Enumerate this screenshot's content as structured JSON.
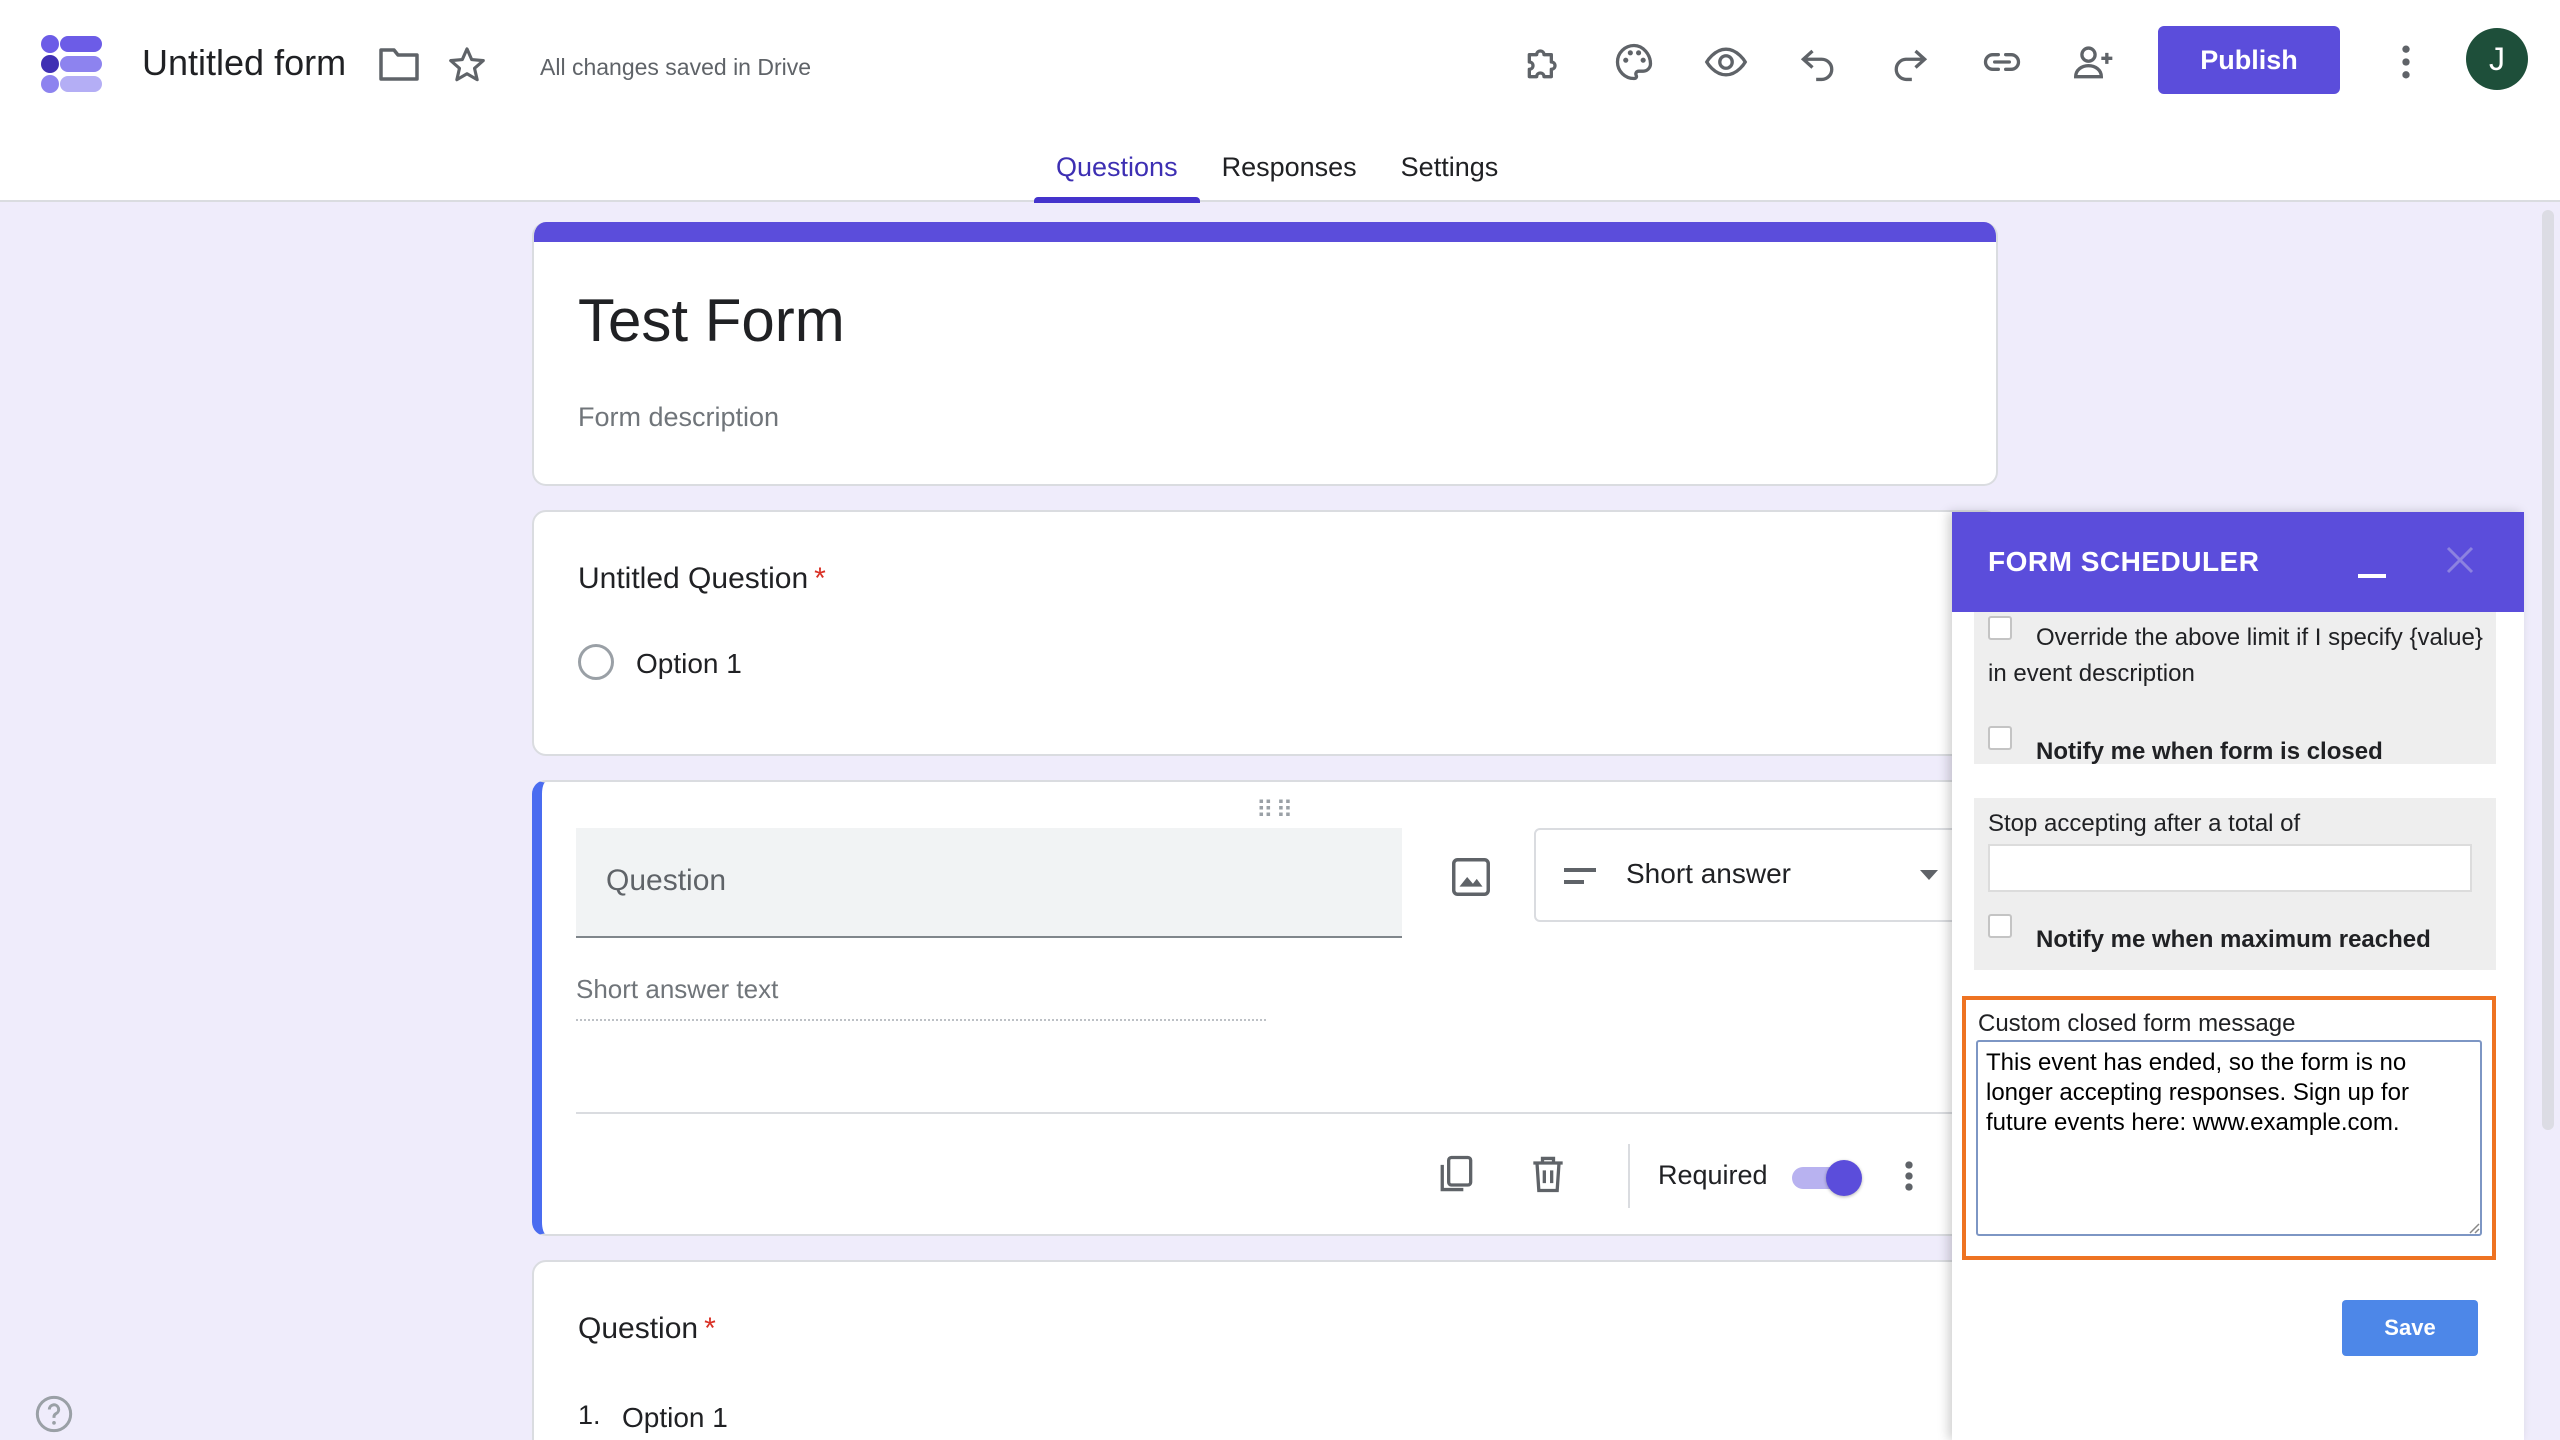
{
  "app": {
    "doc_title": "Untitled form",
    "save_status": "All changes saved in Drive",
    "publish_label": "Publish",
    "avatar_initial": "J",
    "brand_color": "#5b4ddb"
  },
  "toolbar_icons": [
    "addon-icon",
    "palette-icon",
    "preview-eye-icon",
    "undo-icon",
    "redo-icon",
    "link-icon",
    "add-collaborator-icon",
    "more-vert-icon"
  ],
  "tabs": [
    {
      "label": "Questions",
      "active": true
    },
    {
      "label": "Responses",
      "active": false
    },
    {
      "label": "Settings",
      "active": false
    }
  ],
  "form": {
    "title": "Test Form",
    "description_placeholder": "Form description",
    "question1": {
      "title": "Untitled Question",
      "required_mark": "*",
      "option": "Option 1"
    },
    "question2": {
      "title_placeholder": "Question",
      "type": "Short answer",
      "answer_placeholder": "Short answer text",
      "required_label": "Required",
      "required": true
    },
    "question3": {
      "title": "Question",
      "required_mark": "*",
      "option_number": "1.",
      "option": "Option 1"
    }
  },
  "panel": {
    "title": "FORM SCHEDULER",
    "override_label": "Override the above limit if I specify {value} in event description",
    "notify_closed_label": "Notify me when form is closed",
    "stop_after_label": "Stop accepting after a total of",
    "stop_after_value": "",
    "notify_max_label": "Notify me when maximum reached",
    "custom_message_label": "Custom closed form message",
    "custom_message_value": "This event has ended, so the form is no longer accepting responses. Sign up for future events here: www.example.com.",
    "save_label": "Save",
    "highlight_color": "#ee7322"
  }
}
